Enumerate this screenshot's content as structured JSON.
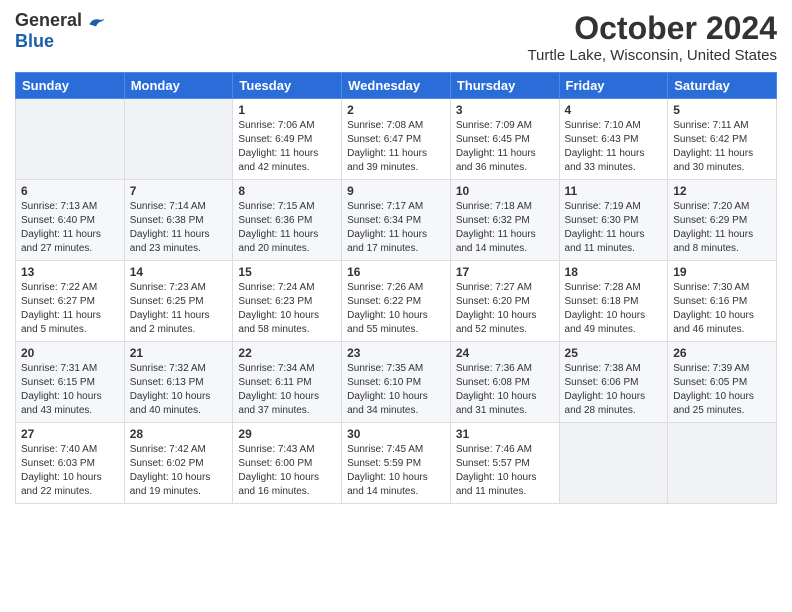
{
  "logo": {
    "general": "General",
    "blue": "Blue"
  },
  "title": "October 2024",
  "location": "Turtle Lake, Wisconsin, United States",
  "days_of_week": [
    "Sunday",
    "Monday",
    "Tuesday",
    "Wednesday",
    "Thursday",
    "Friday",
    "Saturday"
  ],
  "weeks": [
    [
      {
        "day": null
      },
      {
        "day": null
      },
      {
        "day": "1",
        "sunrise": "7:06 AM",
        "sunset": "6:49 PM",
        "daylight": "11 hours and 42 minutes."
      },
      {
        "day": "2",
        "sunrise": "7:08 AM",
        "sunset": "6:47 PM",
        "daylight": "11 hours and 39 minutes."
      },
      {
        "day": "3",
        "sunrise": "7:09 AM",
        "sunset": "6:45 PM",
        "daylight": "11 hours and 36 minutes."
      },
      {
        "day": "4",
        "sunrise": "7:10 AM",
        "sunset": "6:43 PM",
        "daylight": "11 hours and 33 minutes."
      },
      {
        "day": "5",
        "sunrise": "7:11 AM",
        "sunset": "6:42 PM",
        "daylight": "11 hours and 30 minutes."
      }
    ],
    [
      {
        "day": "6",
        "sunrise": "7:13 AM",
        "sunset": "6:40 PM",
        "daylight": "11 hours and 27 minutes."
      },
      {
        "day": "7",
        "sunrise": "7:14 AM",
        "sunset": "6:38 PM",
        "daylight": "11 hours and 23 minutes."
      },
      {
        "day": "8",
        "sunrise": "7:15 AM",
        "sunset": "6:36 PM",
        "daylight": "11 hours and 20 minutes."
      },
      {
        "day": "9",
        "sunrise": "7:17 AM",
        "sunset": "6:34 PM",
        "daylight": "11 hours and 17 minutes."
      },
      {
        "day": "10",
        "sunrise": "7:18 AM",
        "sunset": "6:32 PM",
        "daylight": "11 hours and 14 minutes."
      },
      {
        "day": "11",
        "sunrise": "7:19 AM",
        "sunset": "6:30 PM",
        "daylight": "11 hours and 11 minutes."
      },
      {
        "day": "12",
        "sunrise": "7:20 AM",
        "sunset": "6:29 PM",
        "daylight": "11 hours and 8 minutes."
      }
    ],
    [
      {
        "day": "13",
        "sunrise": "7:22 AM",
        "sunset": "6:27 PM",
        "daylight": "11 hours and 5 minutes."
      },
      {
        "day": "14",
        "sunrise": "7:23 AM",
        "sunset": "6:25 PM",
        "daylight": "11 hours and 2 minutes."
      },
      {
        "day": "15",
        "sunrise": "7:24 AM",
        "sunset": "6:23 PM",
        "daylight": "10 hours and 58 minutes."
      },
      {
        "day": "16",
        "sunrise": "7:26 AM",
        "sunset": "6:22 PM",
        "daylight": "10 hours and 55 minutes."
      },
      {
        "day": "17",
        "sunrise": "7:27 AM",
        "sunset": "6:20 PM",
        "daylight": "10 hours and 52 minutes."
      },
      {
        "day": "18",
        "sunrise": "7:28 AM",
        "sunset": "6:18 PM",
        "daylight": "10 hours and 49 minutes."
      },
      {
        "day": "19",
        "sunrise": "7:30 AM",
        "sunset": "6:16 PM",
        "daylight": "10 hours and 46 minutes."
      }
    ],
    [
      {
        "day": "20",
        "sunrise": "7:31 AM",
        "sunset": "6:15 PM",
        "daylight": "10 hours and 43 minutes."
      },
      {
        "day": "21",
        "sunrise": "7:32 AM",
        "sunset": "6:13 PM",
        "daylight": "10 hours and 40 minutes."
      },
      {
        "day": "22",
        "sunrise": "7:34 AM",
        "sunset": "6:11 PM",
        "daylight": "10 hours and 37 minutes."
      },
      {
        "day": "23",
        "sunrise": "7:35 AM",
        "sunset": "6:10 PM",
        "daylight": "10 hours and 34 minutes."
      },
      {
        "day": "24",
        "sunrise": "7:36 AM",
        "sunset": "6:08 PM",
        "daylight": "10 hours and 31 minutes."
      },
      {
        "day": "25",
        "sunrise": "7:38 AM",
        "sunset": "6:06 PM",
        "daylight": "10 hours and 28 minutes."
      },
      {
        "day": "26",
        "sunrise": "7:39 AM",
        "sunset": "6:05 PM",
        "daylight": "10 hours and 25 minutes."
      }
    ],
    [
      {
        "day": "27",
        "sunrise": "7:40 AM",
        "sunset": "6:03 PM",
        "daylight": "10 hours and 22 minutes."
      },
      {
        "day": "28",
        "sunrise": "7:42 AM",
        "sunset": "6:02 PM",
        "daylight": "10 hours and 19 minutes."
      },
      {
        "day": "29",
        "sunrise": "7:43 AM",
        "sunset": "6:00 PM",
        "daylight": "10 hours and 16 minutes."
      },
      {
        "day": "30",
        "sunrise": "7:45 AM",
        "sunset": "5:59 PM",
        "daylight": "10 hours and 14 minutes."
      },
      {
        "day": "31",
        "sunrise": "7:46 AM",
        "sunset": "5:57 PM",
        "daylight": "10 hours and 11 minutes."
      },
      {
        "day": null
      },
      {
        "day": null
      }
    ]
  ]
}
